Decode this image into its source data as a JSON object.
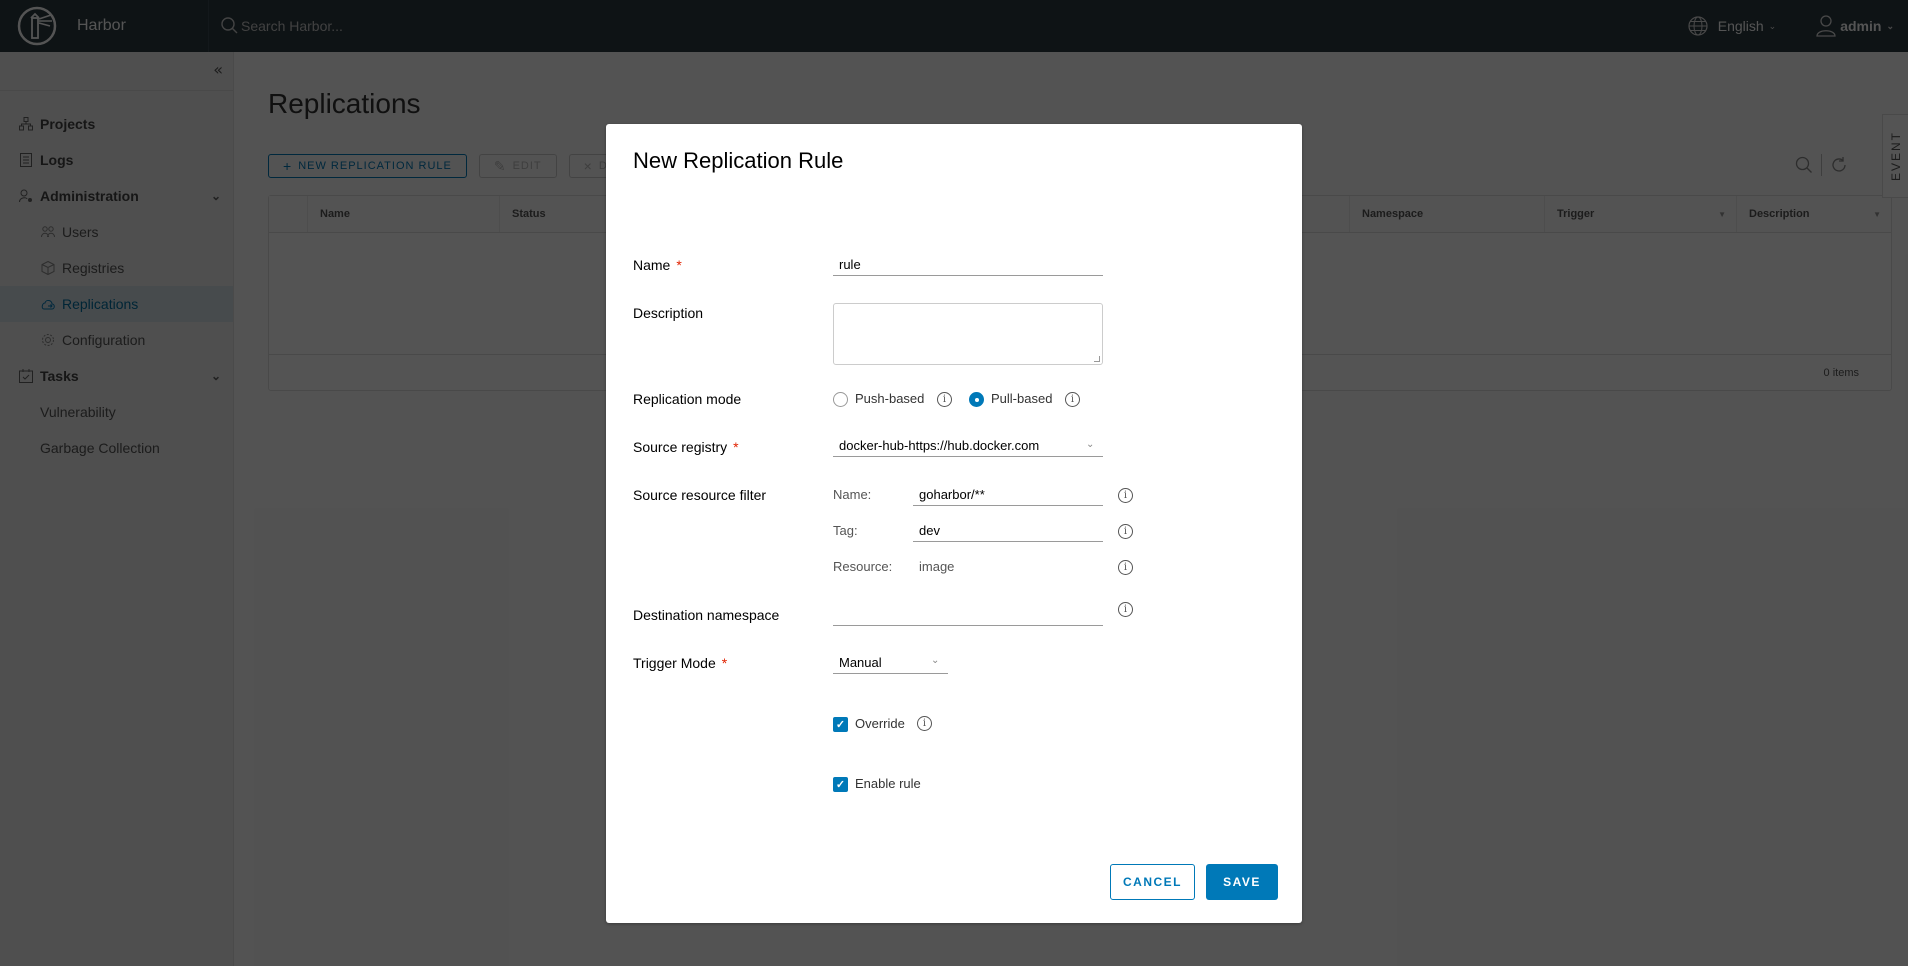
{
  "header": {
    "app_name": "Harbor",
    "search_placeholder": "Search Harbor...",
    "language": "English",
    "user": "admin"
  },
  "sidebar": {
    "items": [
      {
        "label": "Projects",
        "icon": "projects-icon"
      },
      {
        "label": "Logs",
        "icon": "logs-icon"
      },
      {
        "label": "Administration",
        "icon": "administration-icon"
      },
      {
        "label": "Users",
        "icon": "users-icon"
      },
      {
        "label": "Registries",
        "icon": "registries-icon"
      },
      {
        "label": "Replications",
        "icon": "replications-icon"
      },
      {
        "label": "Configuration",
        "icon": "configuration-icon"
      },
      {
        "label": "Tasks",
        "icon": "tasks-icon"
      },
      {
        "label": "Vulnerability"
      },
      {
        "label": "Garbage Collection"
      }
    ],
    "active": "Replications"
  },
  "main": {
    "title": "Replications",
    "toolbar": {
      "new_rule": "NEW REPLICATION RULE",
      "edit": "EDIT",
      "delete_partial": "D"
    },
    "grid": {
      "columns": [
        "Name",
        "Status",
        "Namespace",
        "Trigger",
        "Description"
      ],
      "footer": "0 items"
    },
    "event_tab": "EVENT"
  },
  "modal": {
    "title": "New Replication Rule",
    "name_label": "Name",
    "name_value": "rule",
    "description_label": "Description",
    "description_value": "",
    "mode_label": "Replication mode",
    "mode_options": [
      "Push-based",
      "Pull-based"
    ],
    "mode_selected": "Pull-based",
    "source_registry_label": "Source registry",
    "source_registry_value": "docker-hub-https://hub.docker.com",
    "filter_label": "Source resource filter",
    "filter": {
      "name_label": "Name:",
      "name_value": "goharbor/**",
      "tag_label": "Tag:",
      "tag_value": "dev",
      "resource_label": "Resource:",
      "resource_value": "image"
    },
    "dest_ns_label": "Destination namespace",
    "dest_ns_value": "",
    "trigger_label": "Trigger Mode",
    "trigger_value": "Manual",
    "override_label": "Override",
    "override_checked": true,
    "enable_label": "Enable rule",
    "enable_checked": true,
    "cancel": "CANCEL",
    "save": "SAVE",
    "required_mark": "*",
    "info_glyph": "i",
    "check_glyph": "✓"
  },
  "colors": {
    "primary": "#0079b8",
    "header_bg": "#2b3a42",
    "required": "#e12200"
  }
}
